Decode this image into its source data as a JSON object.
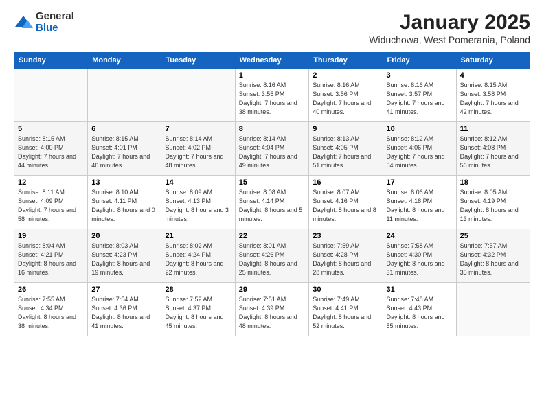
{
  "logo": {
    "general": "General",
    "blue": "Blue"
  },
  "header": {
    "title": "January 2025",
    "location": "Widuchowa, West Pomerania, Poland"
  },
  "weekdays": [
    "Sunday",
    "Monday",
    "Tuesday",
    "Wednesday",
    "Thursday",
    "Friday",
    "Saturday"
  ],
  "weeks": [
    [
      {
        "day": "",
        "info": ""
      },
      {
        "day": "",
        "info": ""
      },
      {
        "day": "",
        "info": ""
      },
      {
        "day": "1",
        "info": "Sunrise: 8:16 AM\nSunset: 3:55 PM\nDaylight: 7 hours\nand 38 minutes."
      },
      {
        "day": "2",
        "info": "Sunrise: 8:16 AM\nSunset: 3:56 PM\nDaylight: 7 hours\nand 40 minutes."
      },
      {
        "day": "3",
        "info": "Sunrise: 8:16 AM\nSunset: 3:57 PM\nDaylight: 7 hours\nand 41 minutes."
      },
      {
        "day": "4",
        "info": "Sunrise: 8:15 AM\nSunset: 3:58 PM\nDaylight: 7 hours\nand 42 minutes."
      }
    ],
    [
      {
        "day": "5",
        "info": "Sunrise: 8:15 AM\nSunset: 4:00 PM\nDaylight: 7 hours\nand 44 minutes."
      },
      {
        "day": "6",
        "info": "Sunrise: 8:15 AM\nSunset: 4:01 PM\nDaylight: 7 hours\nand 46 minutes."
      },
      {
        "day": "7",
        "info": "Sunrise: 8:14 AM\nSunset: 4:02 PM\nDaylight: 7 hours\nand 48 minutes."
      },
      {
        "day": "8",
        "info": "Sunrise: 8:14 AM\nSunset: 4:04 PM\nDaylight: 7 hours\nand 49 minutes."
      },
      {
        "day": "9",
        "info": "Sunrise: 8:13 AM\nSunset: 4:05 PM\nDaylight: 7 hours\nand 51 minutes."
      },
      {
        "day": "10",
        "info": "Sunrise: 8:12 AM\nSunset: 4:06 PM\nDaylight: 7 hours\nand 54 minutes."
      },
      {
        "day": "11",
        "info": "Sunrise: 8:12 AM\nSunset: 4:08 PM\nDaylight: 7 hours\nand 56 minutes."
      }
    ],
    [
      {
        "day": "12",
        "info": "Sunrise: 8:11 AM\nSunset: 4:09 PM\nDaylight: 7 hours\nand 58 minutes."
      },
      {
        "day": "13",
        "info": "Sunrise: 8:10 AM\nSunset: 4:11 PM\nDaylight: 8 hours\nand 0 minutes."
      },
      {
        "day": "14",
        "info": "Sunrise: 8:09 AM\nSunset: 4:13 PM\nDaylight: 8 hours\nand 3 minutes."
      },
      {
        "day": "15",
        "info": "Sunrise: 8:08 AM\nSunset: 4:14 PM\nDaylight: 8 hours\nand 5 minutes."
      },
      {
        "day": "16",
        "info": "Sunrise: 8:07 AM\nSunset: 4:16 PM\nDaylight: 8 hours\nand 8 minutes."
      },
      {
        "day": "17",
        "info": "Sunrise: 8:06 AM\nSunset: 4:18 PM\nDaylight: 8 hours\nand 11 minutes."
      },
      {
        "day": "18",
        "info": "Sunrise: 8:05 AM\nSunset: 4:19 PM\nDaylight: 8 hours\nand 13 minutes."
      }
    ],
    [
      {
        "day": "19",
        "info": "Sunrise: 8:04 AM\nSunset: 4:21 PM\nDaylight: 8 hours\nand 16 minutes."
      },
      {
        "day": "20",
        "info": "Sunrise: 8:03 AM\nSunset: 4:23 PM\nDaylight: 8 hours\nand 19 minutes."
      },
      {
        "day": "21",
        "info": "Sunrise: 8:02 AM\nSunset: 4:24 PM\nDaylight: 8 hours\nand 22 minutes."
      },
      {
        "day": "22",
        "info": "Sunrise: 8:01 AM\nSunset: 4:26 PM\nDaylight: 8 hours\nand 25 minutes."
      },
      {
        "day": "23",
        "info": "Sunrise: 7:59 AM\nSunset: 4:28 PM\nDaylight: 8 hours\nand 28 minutes."
      },
      {
        "day": "24",
        "info": "Sunrise: 7:58 AM\nSunset: 4:30 PM\nDaylight: 8 hours\nand 31 minutes."
      },
      {
        "day": "25",
        "info": "Sunrise: 7:57 AM\nSunset: 4:32 PM\nDaylight: 8 hours\nand 35 minutes."
      }
    ],
    [
      {
        "day": "26",
        "info": "Sunrise: 7:55 AM\nSunset: 4:34 PM\nDaylight: 8 hours\nand 38 minutes."
      },
      {
        "day": "27",
        "info": "Sunrise: 7:54 AM\nSunset: 4:36 PM\nDaylight: 8 hours\nand 41 minutes."
      },
      {
        "day": "28",
        "info": "Sunrise: 7:52 AM\nSunset: 4:37 PM\nDaylight: 8 hours\nand 45 minutes."
      },
      {
        "day": "29",
        "info": "Sunrise: 7:51 AM\nSunset: 4:39 PM\nDaylight: 8 hours\nand 48 minutes."
      },
      {
        "day": "30",
        "info": "Sunrise: 7:49 AM\nSunset: 4:41 PM\nDaylight: 8 hours\nand 52 minutes."
      },
      {
        "day": "31",
        "info": "Sunrise: 7:48 AM\nSunset: 4:43 PM\nDaylight: 8 hours\nand 55 minutes."
      },
      {
        "day": "",
        "info": ""
      }
    ]
  ]
}
